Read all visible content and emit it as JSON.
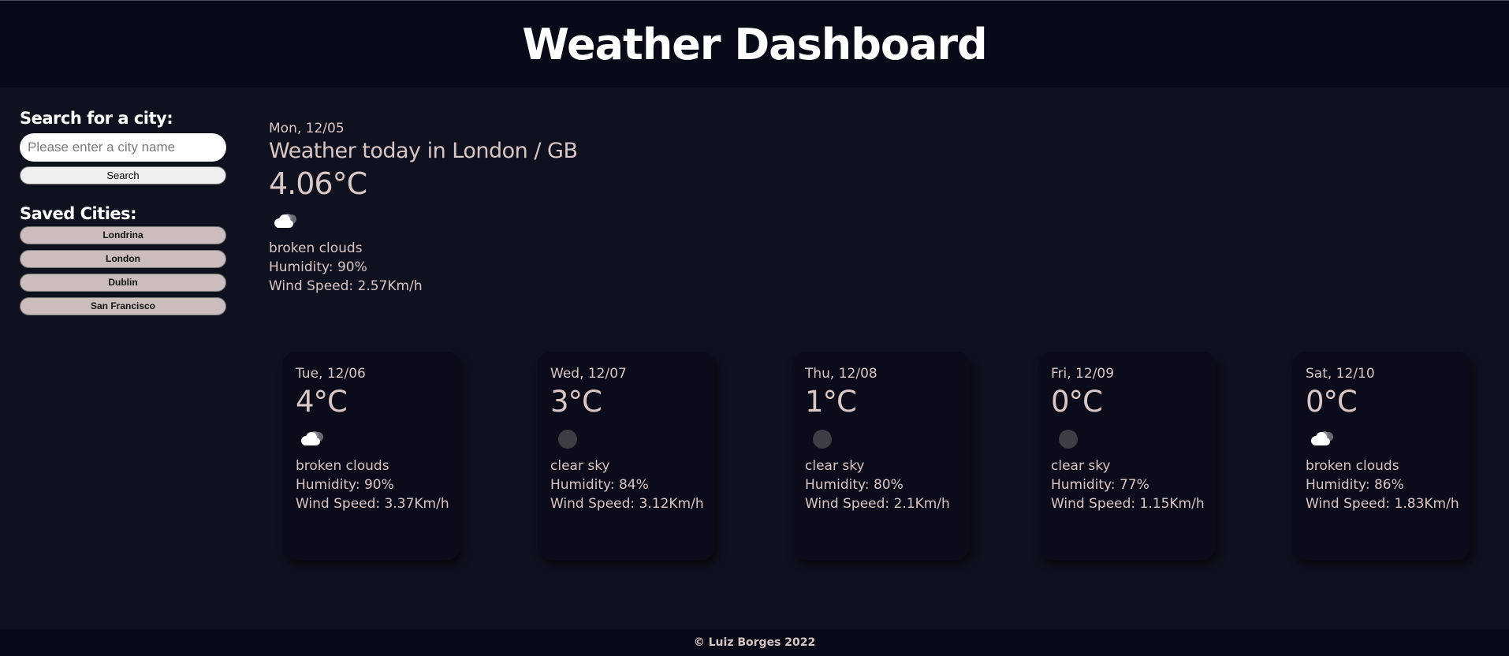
{
  "header": {
    "title": "Weather Dashboard"
  },
  "sidebar": {
    "search_heading": "Search for a city:",
    "search_placeholder": "Please enter a city name",
    "search_button": "Search",
    "saved_heading": "Saved Cities:",
    "cities": [
      "Londrina",
      "London",
      "Dublin",
      "San Francisco"
    ]
  },
  "today": {
    "date": "Mon, 12/05",
    "title": "Weather today in London / GB",
    "temp": "4.06°C",
    "icon": "broken-clouds-icon",
    "description": "broken clouds",
    "humidity": "Humidity: 90%",
    "wind": "Wind Speed: 2.57Km/h"
  },
  "forecast": [
    {
      "date": "Tue, 12/06",
      "temp": "4°C",
      "icon": "broken-clouds-icon",
      "description": "broken clouds",
      "humidity": "Humidity: 90%",
      "wind": "Wind Speed: 3.37Km/h"
    },
    {
      "date": "Wed, 12/07",
      "temp": "3°C",
      "icon": "clear-night-icon",
      "description": "clear sky",
      "humidity": "Humidity: 84%",
      "wind": "Wind Speed: 3.12Km/h"
    },
    {
      "date": "Thu, 12/08",
      "temp": "1°C",
      "icon": "clear-night-icon",
      "description": "clear sky",
      "humidity": "Humidity: 80%",
      "wind": "Wind Speed: 2.1Km/h"
    },
    {
      "date": "Fri, 12/09",
      "temp": "0°C",
      "icon": "clear-night-icon",
      "description": "clear sky",
      "humidity": "Humidity: 77%",
      "wind": "Wind Speed: 1.15Km/h"
    },
    {
      "date": "Sat, 12/10",
      "temp": "0°C",
      "icon": "broken-clouds-icon",
      "description": "broken clouds",
      "humidity": "Humidity: 86%",
      "wind": "Wind Speed: 1.83Km/h"
    }
  ],
  "footer": {
    "text": "© Luiz Borges 2022"
  },
  "colors": {
    "background": "#10111f",
    "header_bg": "#090a17",
    "card_bg": "#0b0b19",
    "text": "#d9c6c6",
    "saved_city_button": "#cbbcbd"
  }
}
